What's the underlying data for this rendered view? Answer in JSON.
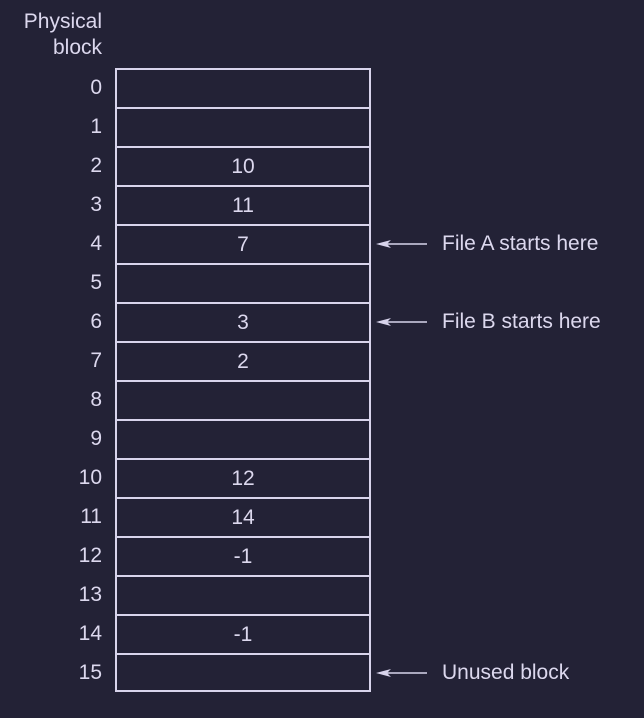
{
  "header": {
    "line1": "Physical",
    "line2": "block"
  },
  "blocks": [
    {
      "index": "0",
      "value": ""
    },
    {
      "index": "1",
      "value": ""
    },
    {
      "index": "2",
      "value": "10"
    },
    {
      "index": "3",
      "value": "11"
    },
    {
      "index": "4",
      "value": "7"
    },
    {
      "index": "5",
      "value": ""
    },
    {
      "index": "6",
      "value": "3"
    },
    {
      "index": "7",
      "value": "2"
    },
    {
      "index": "8",
      "value": ""
    },
    {
      "index": "9",
      "value": ""
    },
    {
      "index": "10",
      "value": "12"
    },
    {
      "index": "11",
      "value": "14"
    },
    {
      "index": "12",
      "value": "-1"
    },
    {
      "index": "13",
      "value": ""
    },
    {
      "index": "14",
      "value": "-1"
    },
    {
      "index": "15",
      "value": ""
    }
  ],
  "annotations": [
    {
      "block": 4,
      "text": "File A starts here"
    },
    {
      "block": 6,
      "text": "File B starts here"
    },
    {
      "block": 15,
      "text": "Unused block"
    }
  ],
  "colors": {
    "background": "#232236",
    "foreground": "#d8d4ec"
  }
}
